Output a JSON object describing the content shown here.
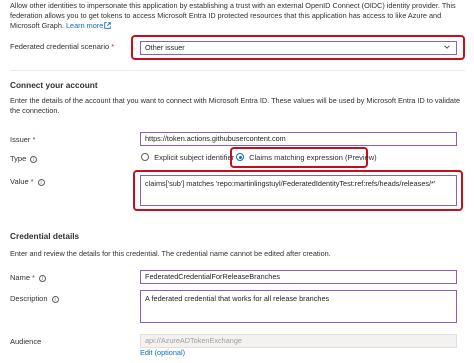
{
  "intro": {
    "text": "Allow other identities to impersonate this application by establishing a trust with an external OpenID Connect (OIDC) identity provider. This federation allows you to get tokens to access Microsoft Entra ID protected resources that this application has access to like Azure and Microsoft Graph.",
    "learn_more": "Learn more"
  },
  "scenario": {
    "label": "Federated credential scenario",
    "required_mark": "*",
    "value": "Other issuer"
  },
  "connect": {
    "heading": "Connect your account",
    "description": "Enter the details of the account that you want to connect with Microsoft Entra ID. These values will be used by Microsoft Entra ID to validate the connection.",
    "issuer_label": "Issuer",
    "issuer_required": "*",
    "issuer_value": "https://token.actions.githubusercontent.com",
    "type_label": "Type",
    "type_option_1": "Explicit subject identifier",
    "type_option_2": "Claims matching expression (Preview)",
    "value_label": "Value",
    "value_required": "*",
    "value_text": "claims['sub'] matches 'repo:martinlingstuyl/FederatedIdentityTest:ref:refs/heads/releases/*'"
  },
  "credential": {
    "heading": "Credential details",
    "description": "Enter and review the details for this credential. The credential name cannot be edited after creation.",
    "name_label": "Name",
    "name_required": "*",
    "name_value": "FederatedCredentialForReleaseBranches",
    "desc_label": "Description",
    "desc_value": "A federated credential that works for all release branches",
    "audience_label": "Audience",
    "audience_value": "api://AzureADTokenExchange",
    "edit_link": "Edit (optional)"
  },
  "colors": {
    "highlight": "#c50f1f",
    "link": "#0f6cbd",
    "input_border": "#8a5dbf"
  }
}
